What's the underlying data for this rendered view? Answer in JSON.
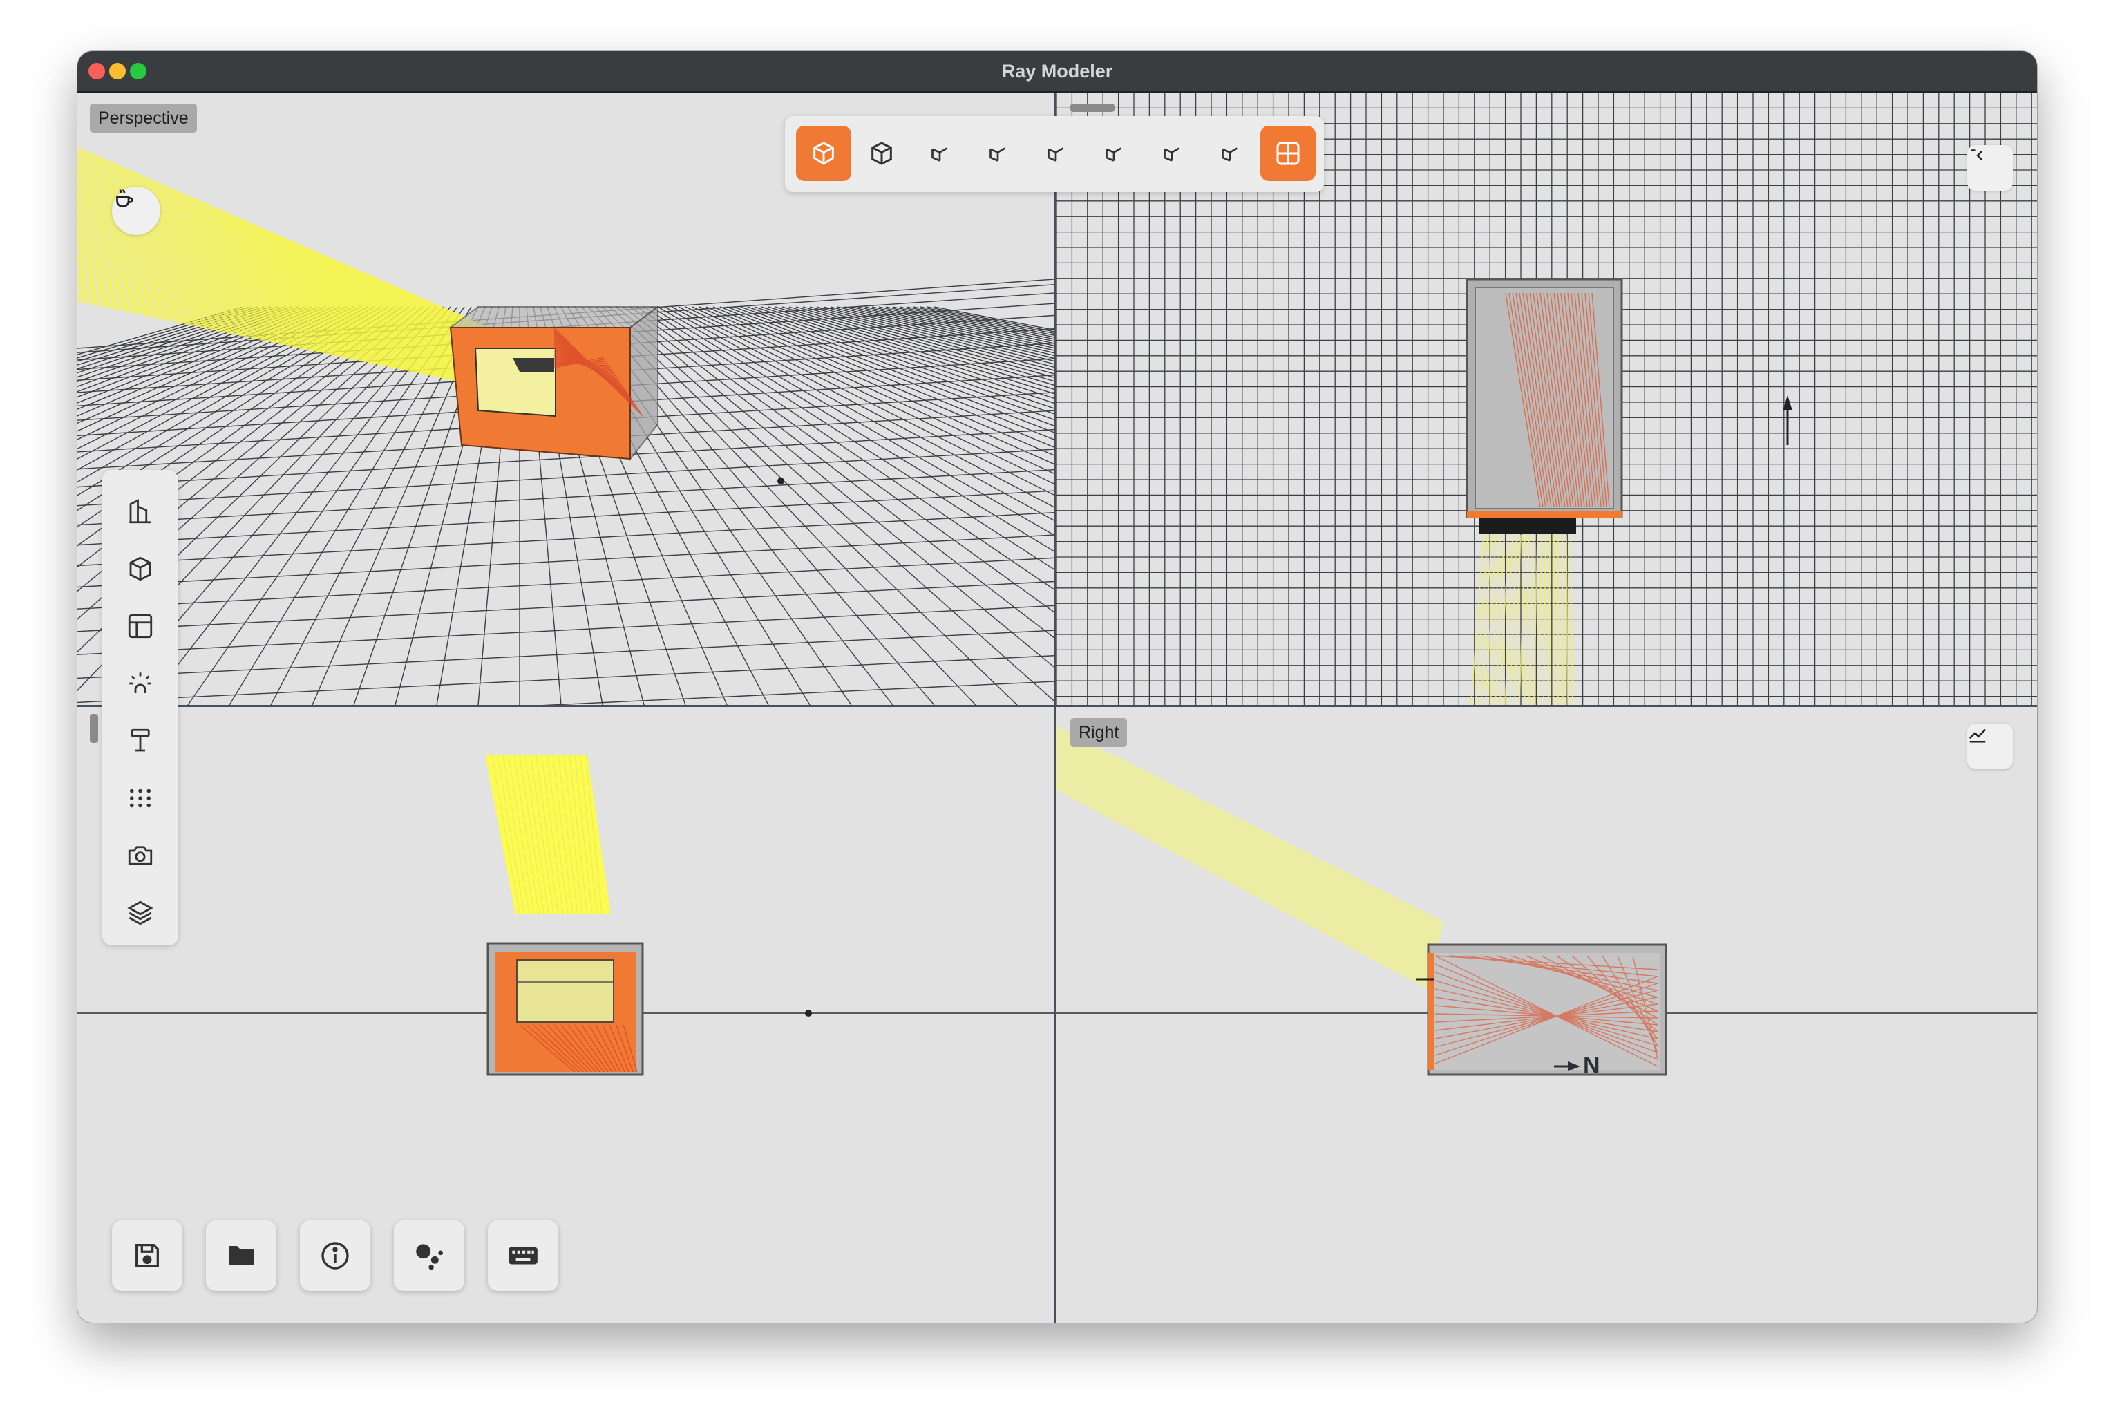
{
  "window": {
    "title": "Ray Modeler"
  },
  "viewports": {
    "perspective": {
      "label": "Perspective"
    },
    "right": {
      "label": "Right"
    }
  },
  "compass": {
    "north_label": "N"
  },
  "view_toolbar": {
    "buttons": [
      {
        "name": "perspective-view-button",
        "icon": "isometric-box-icon",
        "active": true
      },
      {
        "name": "orthographic-view-button",
        "icon": "cube-icon",
        "active": false
      },
      {
        "name": "view-angle-1-button",
        "icon": "cube-corner-icon",
        "active": false
      },
      {
        "name": "view-angle-2-button",
        "icon": "cube-corner-icon",
        "active": false
      },
      {
        "name": "view-angle-3-button",
        "icon": "cube-corner-icon",
        "active": false
      },
      {
        "name": "view-angle-4-button",
        "icon": "cube-corner-icon",
        "active": false
      },
      {
        "name": "view-angle-5-button",
        "icon": "cube-corner-icon",
        "active": false
      },
      {
        "name": "view-angle-6-button",
        "icon": "cube-corner-icon",
        "active": false
      },
      {
        "name": "quad-view-button",
        "icon": "grid-quad-icon",
        "active": true
      }
    ]
  },
  "side_toolbar": {
    "items": [
      "building-icon",
      "cube-icon",
      "layout-icon",
      "sun-icon",
      "sensor-icon",
      "dot-grid-icon",
      "camera-icon",
      "layers-icon"
    ]
  },
  "bottom_toolbar": {
    "items": [
      "save-icon",
      "folder-icon",
      "info-icon",
      "assistant-icon",
      "keyboard-icon"
    ]
  },
  "colors": {
    "accent": "#f07a34",
    "ray_yellow": "#ffff3a",
    "ray_red": "#e04a2a",
    "panel": "#e2e2e2"
  }
}
